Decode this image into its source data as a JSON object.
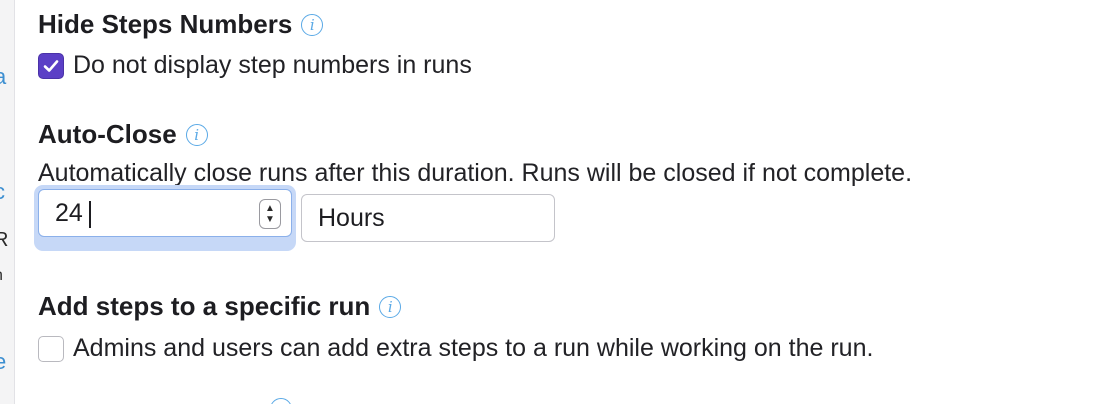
{
  "left_fragments": [
    "a",
    "c",
    "R",
    "h",
    "e"
  ],
  "hide_steps": {
    "heading": "Hide Steps Numbers",
    "checkbox_checked": true,
    "checkbox_label": "Do not display step numbers in runs"
  },
  "auto_close": {
    "heading": "Auto-Close",
    "description": "Automatically close runs after this duration. Runs will be closed if not complete.",
    "duration_value": "24",
    "duration_unit": "Hours"
  },
  "add_steps": {
    "heading": "Add steps to a specific run",
    "checkbox_checked": false,
    "checkbox_label": "Admins and users can add extra steps to a run while working on the run."
  },
  "icons": {
    "info": "info-icon",
    "check": "check-icon",
    "stepper": "stepper-arrows-icon"
  },
  "colors": {
    "accent": "#5b3fc6",
    "info": "#5aa9e6",
    "focus_ring": "#c6d8f7"
  }
}
